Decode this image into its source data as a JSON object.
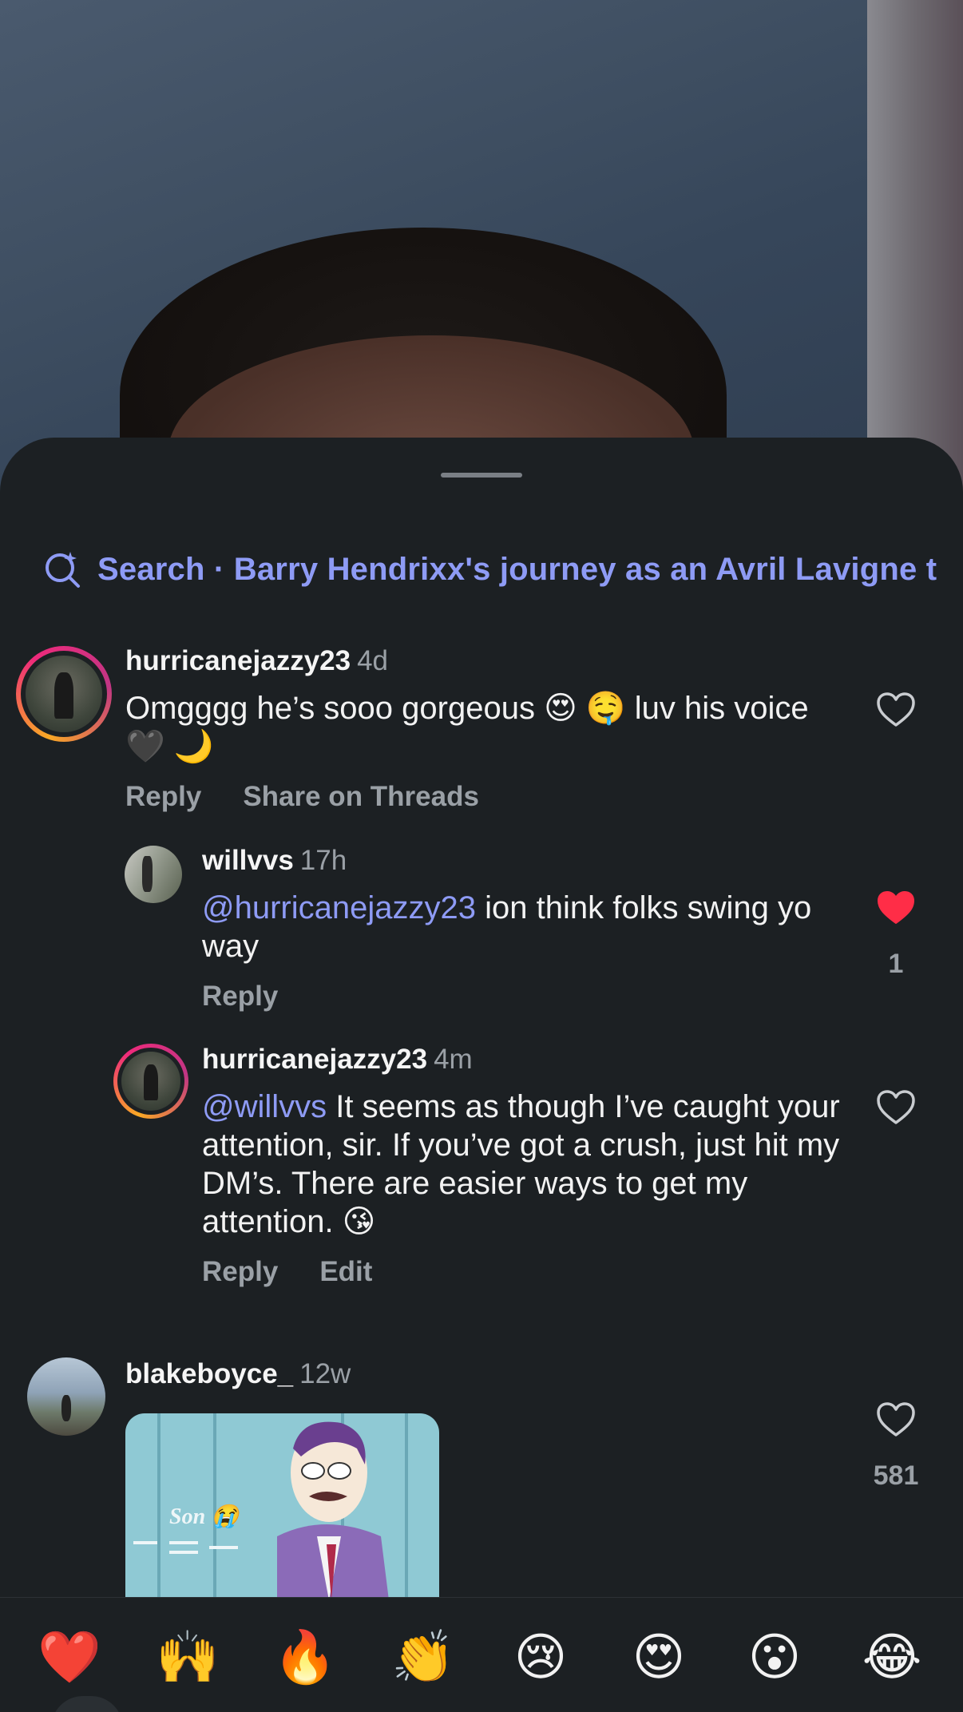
{
  "search": {
    "label": "Search · Barry Hendrixx's journey as an Avril Lavigne t"
  },
  "comments": [
    {
      "username": "hurricanejazzy23",
      "time": "4d",
      "text": "Omgggg he’s sooo gorgeous 😍 🤤 luv his voice 🖤 🌙",
      "actions": [
        "Reply",
        "Share on Threads"
      ],
      "liked": false
    },
    {
      "username": "willvvs",
      "time": "17h",
      "mention": "@hurricanejazzy23",
      "text": " ion think folks swing yo way",
      "actions": [
        "Reply"
      ],
      "liked": true,
      "like_count": "1"
    },
    {
      "username": "hurricanejazzy23",
      "time": "4m",
      "mention": "@willvvs",
      "text": " It seems as though I’ve caught your attention, sir. If you’ve got a crush, just hit my DM’s. There are easier ways to get my attention. 😘",
      "actions": [
        "Reply",
        "Edit"
      ],
      "liked": false
    },
    {
      "username": "blakeboyce_",
      "time": "12w",
      "gif_caption": "Son 😭",
      "liked": false,
      "like_count": "581"
    }
  ],
  "reactions": [
    "❤️",
    "🙌",
    "🔥",
    "👏",
    "😢",
    "😍",
    "😮",
    "😂"
  ],
  "colors": {
    "background": "#1c2023",
    "mention": "#8e9bf5",
    "like_red": "#ff2d47",
    "muted": "#9aa0a6"
  }
}
